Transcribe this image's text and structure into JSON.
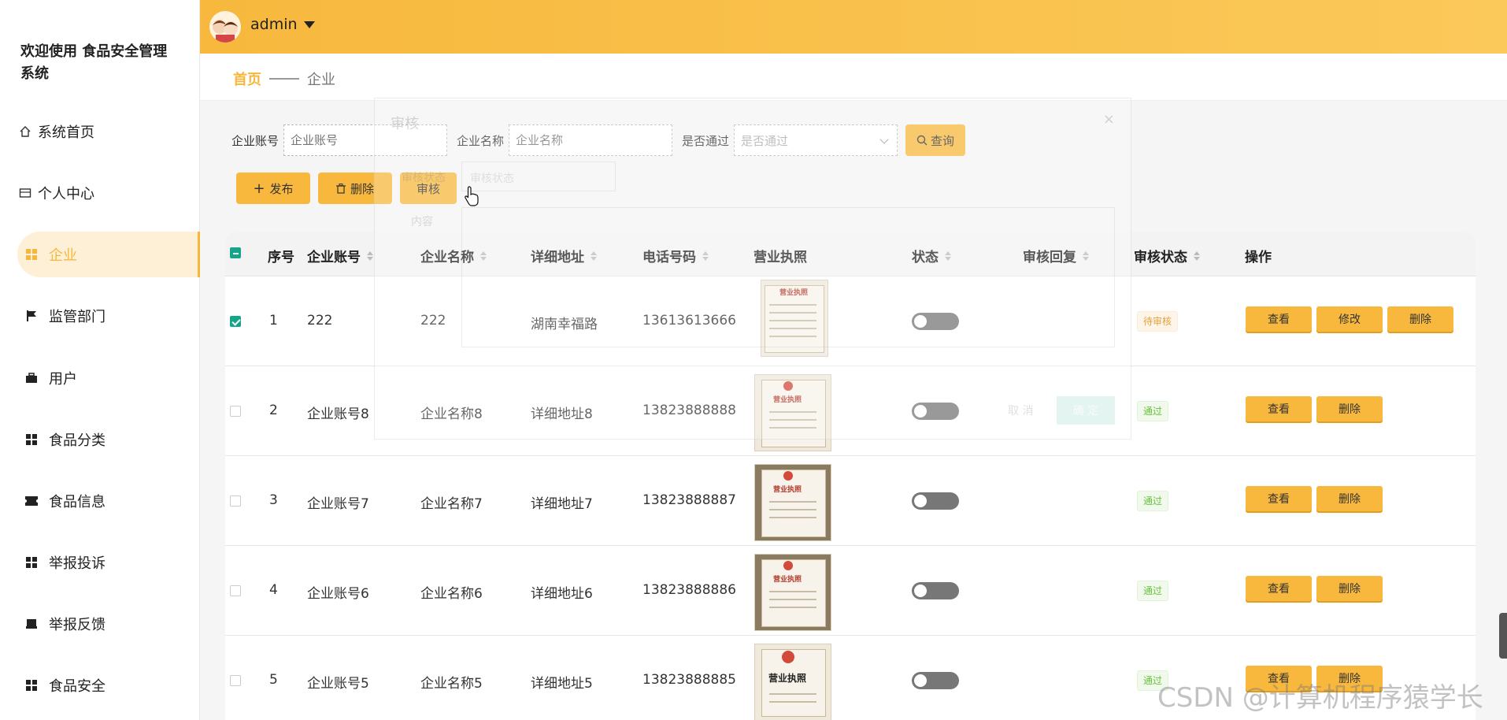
{
  "sidebar": {
    "brand": "欢迎使用 食品安全管理系统",
    "items": [
      {
        "label": "系统首页",
        "icon": "home-icon"
      },
      {
        "label": "个人中心",
        "icon": "card-icon"
      },
      {
        "label": "企业",
        "icon": "grid-icon",
        "active": true
      },
      {
        "label": "监管部门",
        "icon": "flag-icon"
      },
      {
        "label": "用户",
        "icon": "briefcase-icon"
      },
      {
        "label": "食品分类",
        "icon": "grid-icon"
      },
      {
        "label": "食品信息",
        "icon": "ticket-icon"
      },
      {
        "label": "举报投诉",
        "icon": "grid-icon"
      },
      {
        "label": "举报反馈",
        "icon": "inbox-icon"
      },
      {
        "label": "食品安全",
        "icon": "grid-icon"
      }
    ]
  },
  "header": {
    "username": "admin"
  },
  "breadcrumb": {
    "home": "首页",
    "current": "企业"
  },
  "search": {
    "account_label": "企业账号",
    "account_placeholder": "企业账号",
    "name_label": "企业名称",
    "name_placeholder": "企业名称",
    "pass_label": "是否通过",
    "pass_placeholder": "是否通过",
    "query_button": "查询"
  },
  "toolbar": {
    "publish": "发布",
    "delete": "删除",
    "review": "审核"
  },
  "table": {
    "headers": {
      "index": "序号",
      "account": "企业账号",
      "name": "企业名称",
      "address": "详细地址",
      "phone": "电话号码",
      "license": "营业执照",
      "status": "状态",
      "reply": "审核回复",
      "review_status": "审核状态",
      "ops": "操作"
    },
    "rows": [
      {
        "index": "1",
        "account": "222",
        "name": "222",
        "address": "湖南幸福路",
        "phone": "13613613666",
        "review_status": "待审核",
        "checked": true,
        "ops": [
          "查看",
          "修改",
          "删除"
        ]
      },
      {
        "index": "2",
        "account": "企业账号8",
        "name": "企业名称8",
        "address": "详细地址8",
        "phone": "13823888888",
        "review_status": "通过",
        "ops": [
          "查看",
          "删除"
        ]
      },
      {
        "index": "3",
        "account": "企业账号7",
        "name": "企业名称7",
        "address": "详细地址7",
        "phone": "13823888887",
        "review_status": "通过",
        "ops": [
          "查看",
          "删除"
        ]
      },
      {
        "index": "4",
        "account": "企业账号6",
        "name": "企业名称6",
        "address": "详细地址6",
        "phone": "13823888886",
        "review_status": "通过",
        "ops": [
          "查看",
          "删除"
        ]
      },
      {
        "index": "5",
        "account": "企业账号5",
        "name": "企业名称5",
        "address": "详细地址5",
        "phone": "13823888885",
        "review_status": "通过",
        "ops": [
          "查看",
          "删除"
        ]
      }
    ],
    "license_text": "营业执照"
  },
  "dialog": {
    "title": "审核",
    "close": "×",
    "status_label": "审核状态",
    "status_placeholder": "审核状态",
    "content_label": "内容",
    "cancel": "取 消",
    "confirm": "确 定"
  },
  "watermark": "CSDN @计算机程序猿学长",
  "colors": {
    "accent": "#f7b83d",
    "checkbox": "#17a589",
    "pending": "#e6a23c",
    "pass": "#67c23a"
  }
}
